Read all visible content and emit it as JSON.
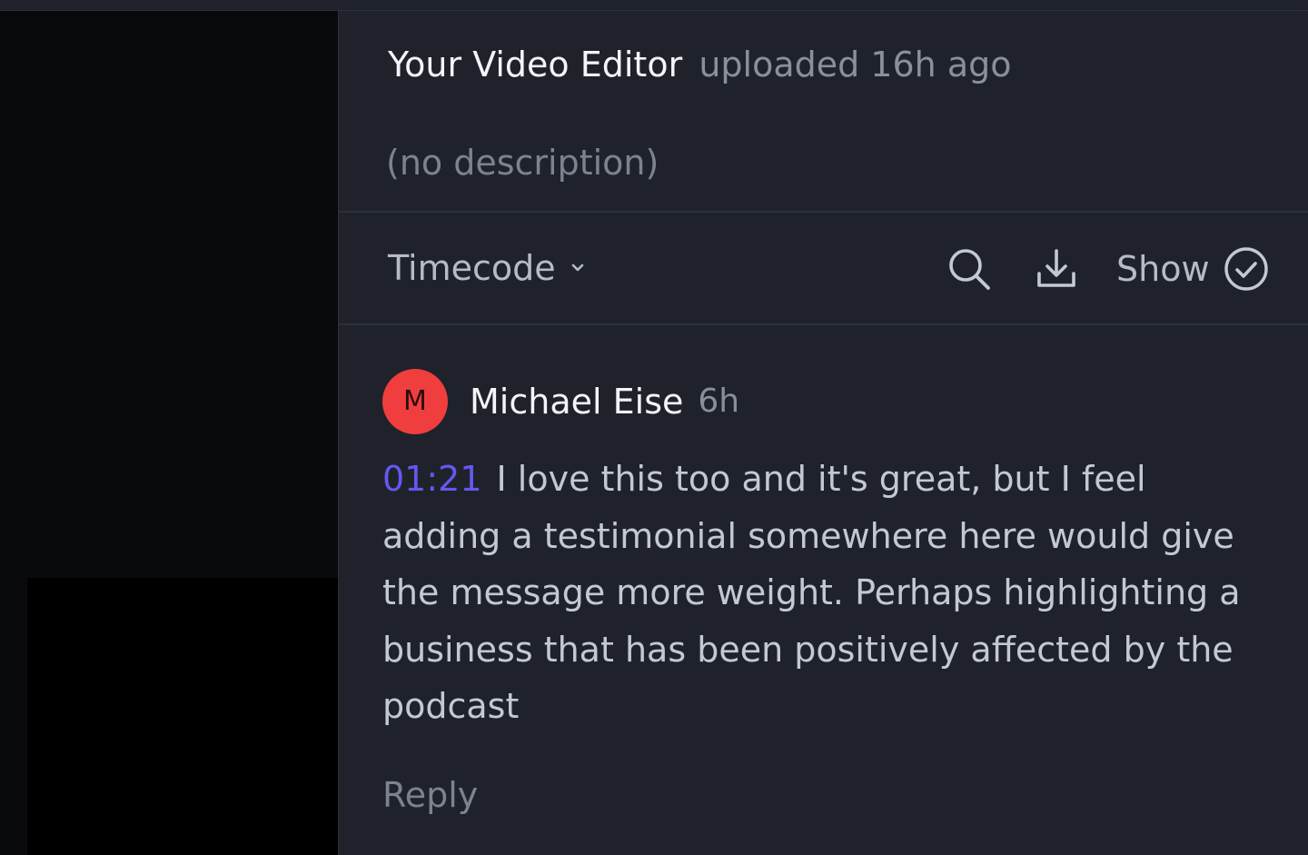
{
  "upload": {
    "uploader": "Your Video Editor",
    "uploaded_text": "uploaded 16h ago",
    "description": "(no description)"
  },
  "toolbar": {
    "timecode_label": "Timecode",
    "show_label": "Show"
  },
  "icons": {
    "chevron": "chevron-down-icon",
    "search": "search-icon",
    "download": "download-icon",
    "check": "check-circle-icon"
  },
  "comment": {
    "avatar_initial": "M",
    "author": "Michael Eise",
    "time": "6h",
    "timestamp": "01:21",
    "text": "I love this too and it's great, but I feel adding  a testimonial somewhere here would give the message more weight. Perhaps highlighting a business that has been positively affected by the podcast"
  },
  "reply_label": "Reply",
  "colors": {
    "panel_bg": "#1f222b",
    "timestamp": "#6458f2",
    "avatar": "#f03e3e"
  }
}
